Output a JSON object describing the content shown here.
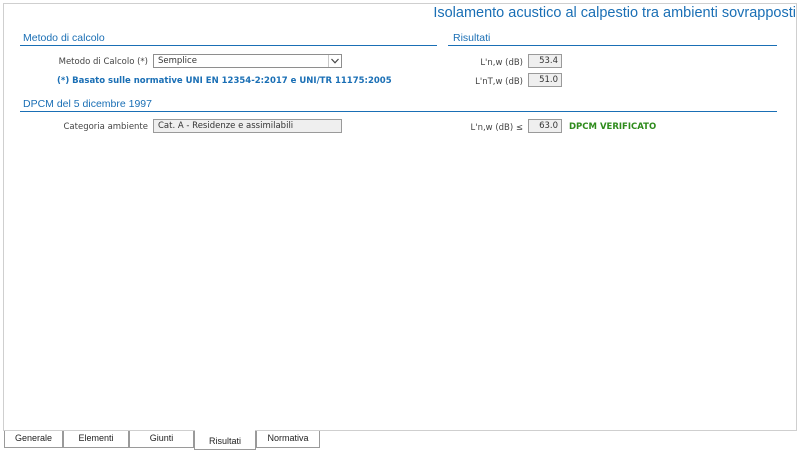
{
  "header": {
    "title": "Isolamento acustico al calpestio tra ambienti sovrapposti"
  },
  "metodo": {
    "section_title": "Metodo di calcolo",
    "method_label": "Metodo di Calcolo (*)",
    "method_value": "Semplice",
    "note": "(*) Basato sulle normative UNI EN 12354-2:2017 e UNI/TR 11175:2005"
  },
  "risultati": {
    "section_title": "Risultati",
    "lnw_label": "L'n,w (dB)",
    "lnw_value": "53.4",
    "lntw_label": "L'nT,w (dB)",
    "lntw_value": "51.0"
  },
  "dpcm": {
    "section_title": "DPCM del 5 dicembre 1997",
    "category_label": "Categoria ambiente",
    "category_value": "Cat. A - Residenze e assimilabili",
    "limit_label": "L'n,w (dB) ≤",
    "limit_value": "63.0",
    "status": "DPCM VERIFICATO"
  },
  "tabs": [
    {
      "label": "Generale"
    },
    {
      "label": "Elementi"
    },
    {
      "label": "Giunti"
    },
    {
      "label": "Risultati",
      "active": true
    },
    {
      "label": "Normativa"
    }
  ],
  "colors": {
    "accent": "#1a6fb5",
    "success": "#2e8b1c"
  },
  "icons": {
    "dropdown": "chevron-down-icon"
  }
}
